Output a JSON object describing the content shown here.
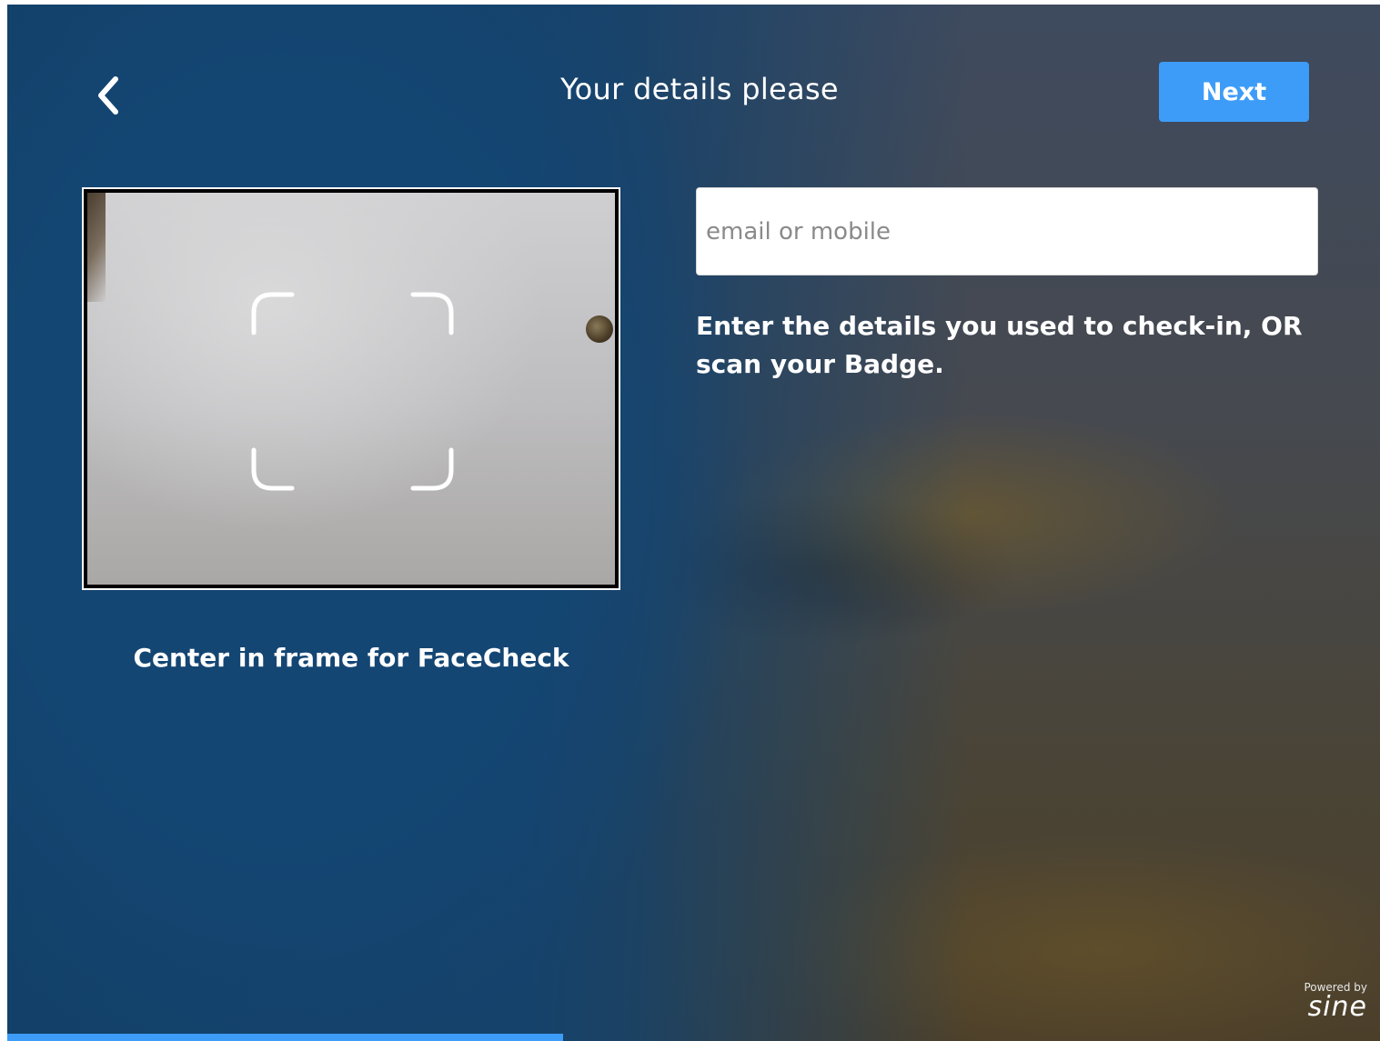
{
  "header": {
    "title": "Your details please",
    "next_label": "Next"
  },
  "camera": {
    "caption": "Center in frame for FaceCheck"
  },
  "form": {
    "contact_placeholder": "email or mobile",
    "contact_value": "",
    "instructions": "Enter the details you used to check-in, OR scan your Badge."
  },
  "footer": {
    "powered_by": "Powered by",
    "brand": "sine"
  },
  "progress": {
    "fraction": 0.405
  },
  "colors": {
    "accent": "#3d9cf7",
    "panel_blue": "#14466c"
  },
  "icons": {
    "back": "chevron-left-icon",
    "frame_guide": "face-frame-guide-icon"
  }
}
